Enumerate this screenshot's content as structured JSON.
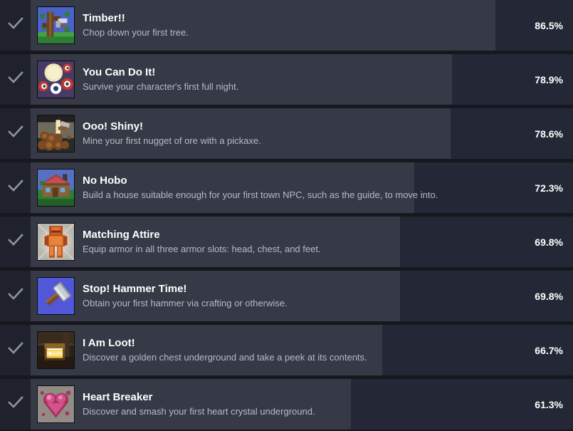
{
  "colors": {
    "page_background": "#16181d",
    "row_background": "#242836",
    "progress_fill": "#363a47",
    "check_column": "#1f222c",
    "title_text": "#ffffff",
    "description_text": "#b5bac6",
    "percent_text": "#ffffff",
    "check_mark": "#8d93a3"
  },
  "achievements": [
    {
      "unlocked_icon": "check-icon",
      "icon_name": "timber-achievement-icon",
      "title": "Timber!!",
      "description": "Chop down your first tree.",
      "percent_label": "86.5%",
      "percent_value": 86.5
    },
    {
      "unlocked_icon": "check-icon",
      "icon_name": "you-can-do-it-achievement-icon",
      "title": "You Can Do It!",
      "description": "Survive your character's first full night.",
      "percent_label": "78.9%",
      "percent_value": 78.9
    },
    {
      "unlocked_icon": "check-icon",
      "icon_name": "ooo-shiny-achievement-icon",
      "title": "Ooo! Shiny!",
      "description": "Mine your first nugget of ore with a pickaxe.",
      "percent_label": "78.6%",
      "percent_value": 78.6
    },
    {
      "unlocked_icon": "check-icon",
      "icon_name": "no-hobo-achievement-icon",
      "title": "No Hobo",
      "description": "Build a house suitable enough for your first town NPC, such as the guide, to move into.",
      "percent_label": "72.3%",
      "percent_value": 72.3
    },
    {
      "unlocked_icon": "check-icon",
      "icon_name": "matching-attire-achievement-icon",
      "title": "Matching Attire",
      "description": "Equip armor in all three armor slots: head, chest, and feet.",
      "percent_label": "69.8%",
      "percent_value": 69.8
    },
    {
      "unlocked_icon": "check-icon",
      "icon_name": "stop-hammer-time-achievement-icon",
      "title": "Stop! Hammer Time!",
      "description": "Obtain your first hammer via crafting or otherwise.",
      "percent_label": "69.8%",
      "percent_value": 69.8
    },
    {
      "unlocked_icon": "check-icon",
      "icon_name": "i-am-loot-achievement-icon",
      "title": "I Am Loot!",
      "description": "Discover a golden chest underground and take a peek at its contents.",
      "percent_label": "66.7%",
      "percent_value": 66.7
    },
    {
      "unlocked_icon": "check-icon",
      "icon_name": "heart-breaker-achievement-icon",
      "title": "Heart Breaker",
      "description": "Discover and smash your first heart crystal underground.",
      "percent_label": "61.3%",
      "percent_value": 61.3
    }
  ]
}
